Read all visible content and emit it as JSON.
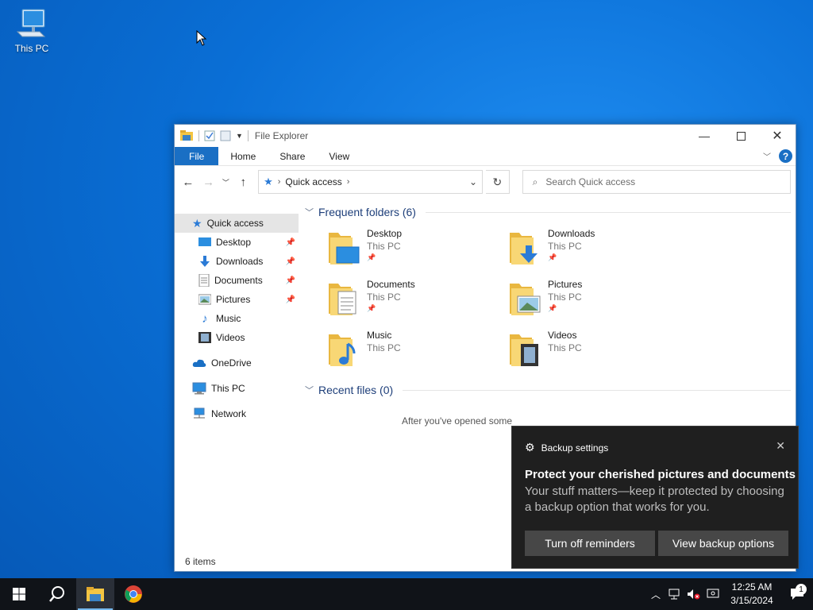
{
  "desktop": {
    "icons": [
      {
        "label": "This PC",
        "icon": "this-pc-icon"
      }
    ]
  },
  "explorer": {
    "title": "File Explorer",
    "ribbon_tabs": [
      "File",
      "Home",
      "Share",
      "View"
    ],
    "address": {
      "crumbs": [
        "Quick access"
      ]
    },
    "search": {
      "placeholder": "Search Quick access"
    },
    "sidebar": {
      "quick_access": {
        "label": "Quick access",
        "icon": "star-icon"
      },
      "pinned": [
        {
          "label": "Desktop",
          "icon": "desktop-icon",
          "pinned": true
        },
        {
          "label": "Downloads",
          "icon": "downloads-icon",
          "pinned": true
        },
        {
          "label": "Documents",
          "icon": "documents-icon",
          "pinned": true
        },
        {
          "label": "Pictures",
          "icon": "pictures-icon",
          "pinned": true
        },
        {
          "label": "Music",
          "icon": "music-icon",
          "pinned": false
        },
        {
          "label": "Videos",
          "icon": "videos-icon",
          "pinned": false
        }
      ],
      "roots": [
        {
          "label": "OneDrive",
          "icon": "cloud-icon"
        },
        {
          "label": "This PC",
          "icon": "computer-icon"
        },
        {
          "label": "Network",
          "icon": "network-icon"
        }
      ]
    },
    "frequent": {
      "header": "Frequent folders (6)",
      "folders": [
        {
          "name": "Desktop",
          "location": "This PC",
          "pinned": true,
          "icon": "desktop-folder-icon"
        },
        {
          "name": "Downloads",
          "location": "This PC",
          "pinned": true,
          "icon": "downloads-folder-icon"
        },
        {
          "name": "Documents",
          "location": "This PC",
          "pinned": true,
          "icon": "documents-folder-icon"
        },
        {
          "name": "Pictures",
          "location": "This PC",
          "pinned": true,
          "icon": "pictures-folder-icon"
        },
        {
          "name": "Music",
          "location": "This PC",
          "pinned": false,
          "icon": "music-folder-icon"
        },
        {
          "name": "Videos",
          "location": "This PC",
          "pinned": false,
          "icon": "videos-folder-icon"
        }
      ]
    },
    "recent": {
      "header": "Recent files (0)",
      "empty_message": "After you've opened some"
    },
    "status": "6 items"
  },
  "toast": {
    "app": "Backup settings",
    "title": "Protect your cherished pictures and documents",
    "body": "Your stuff matters—keep it protected by choosing a backup option that works for you.",
    "buttons": [
      "Turn off reminders",
      "View backup options"
    ]
  },
  "taskbar": {
    "clock_time": "12:25 AM",
    "clock_date": "3/15/2024",
    "notification_count": "1"
  },
  "colors": {
    "accent": "#1a6fc4",
    "taskbar": "#101318",
    "toast_bg": "#1f1f1f",
    "section_header": "#1e3f7a"
  }
}
